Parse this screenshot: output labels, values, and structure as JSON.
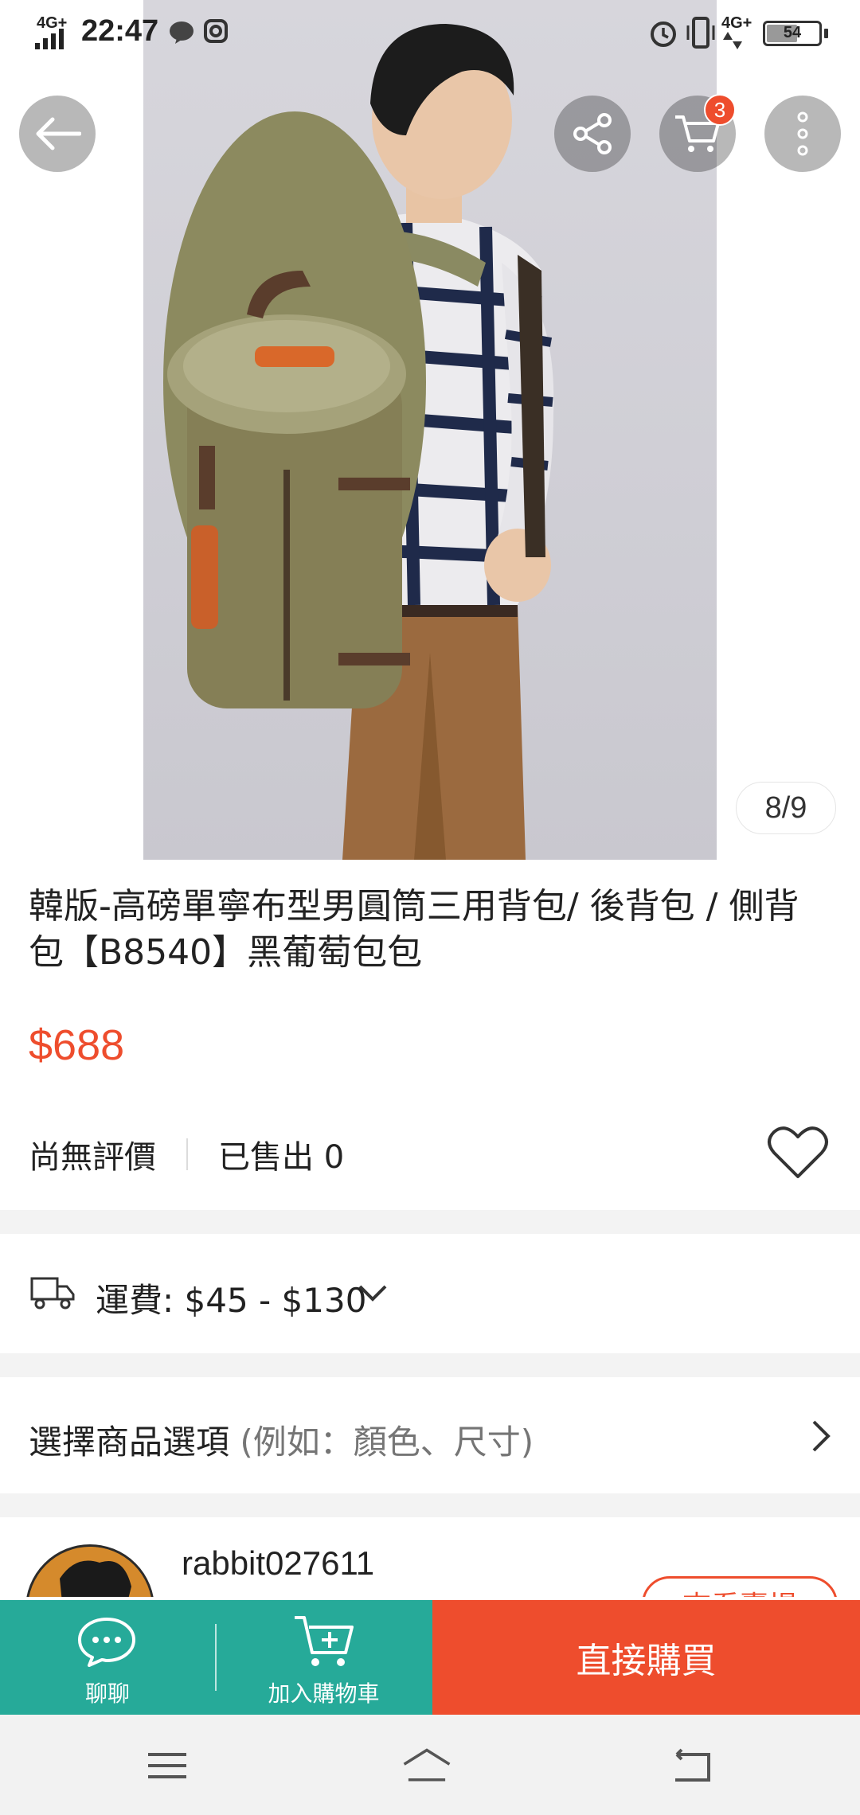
{
  "status_bar": {
    "network": "4G+",
    "time": "22:47",
    "right_network": "4G+",
    "battery": "54"
  },
  "gallery": {
    "counter": "8/9",
    "cart_badge": "3"
  },
  "product": {
    "title": "韓版-高磅單寧布型男圓筒三用背包/ 後背包 / 側背包【B8540】黑葡萄包包",
    "price": "$688",
    "rating": "尚無評價",
    "sold": "已售出 0"
  },
  "shipping": {
    "text": "運費: $45 - $130"
  },
  "variation": {
    "label": "選擇商品選項",
    "hint": " (例如：顏色、尺寸)"
  },
  "shop": {
    "name": "rabbit027611",
    "button": "查看賣場"
  },
  "actions": {
    "chat": "聊聊",
    "add_to_cart": "加入購物車",
    "buy_now": "直接購買"
  },
  "colors": {
    "accent": "#ee4d2d",
    "teal": "#26aa99"
  }
}
